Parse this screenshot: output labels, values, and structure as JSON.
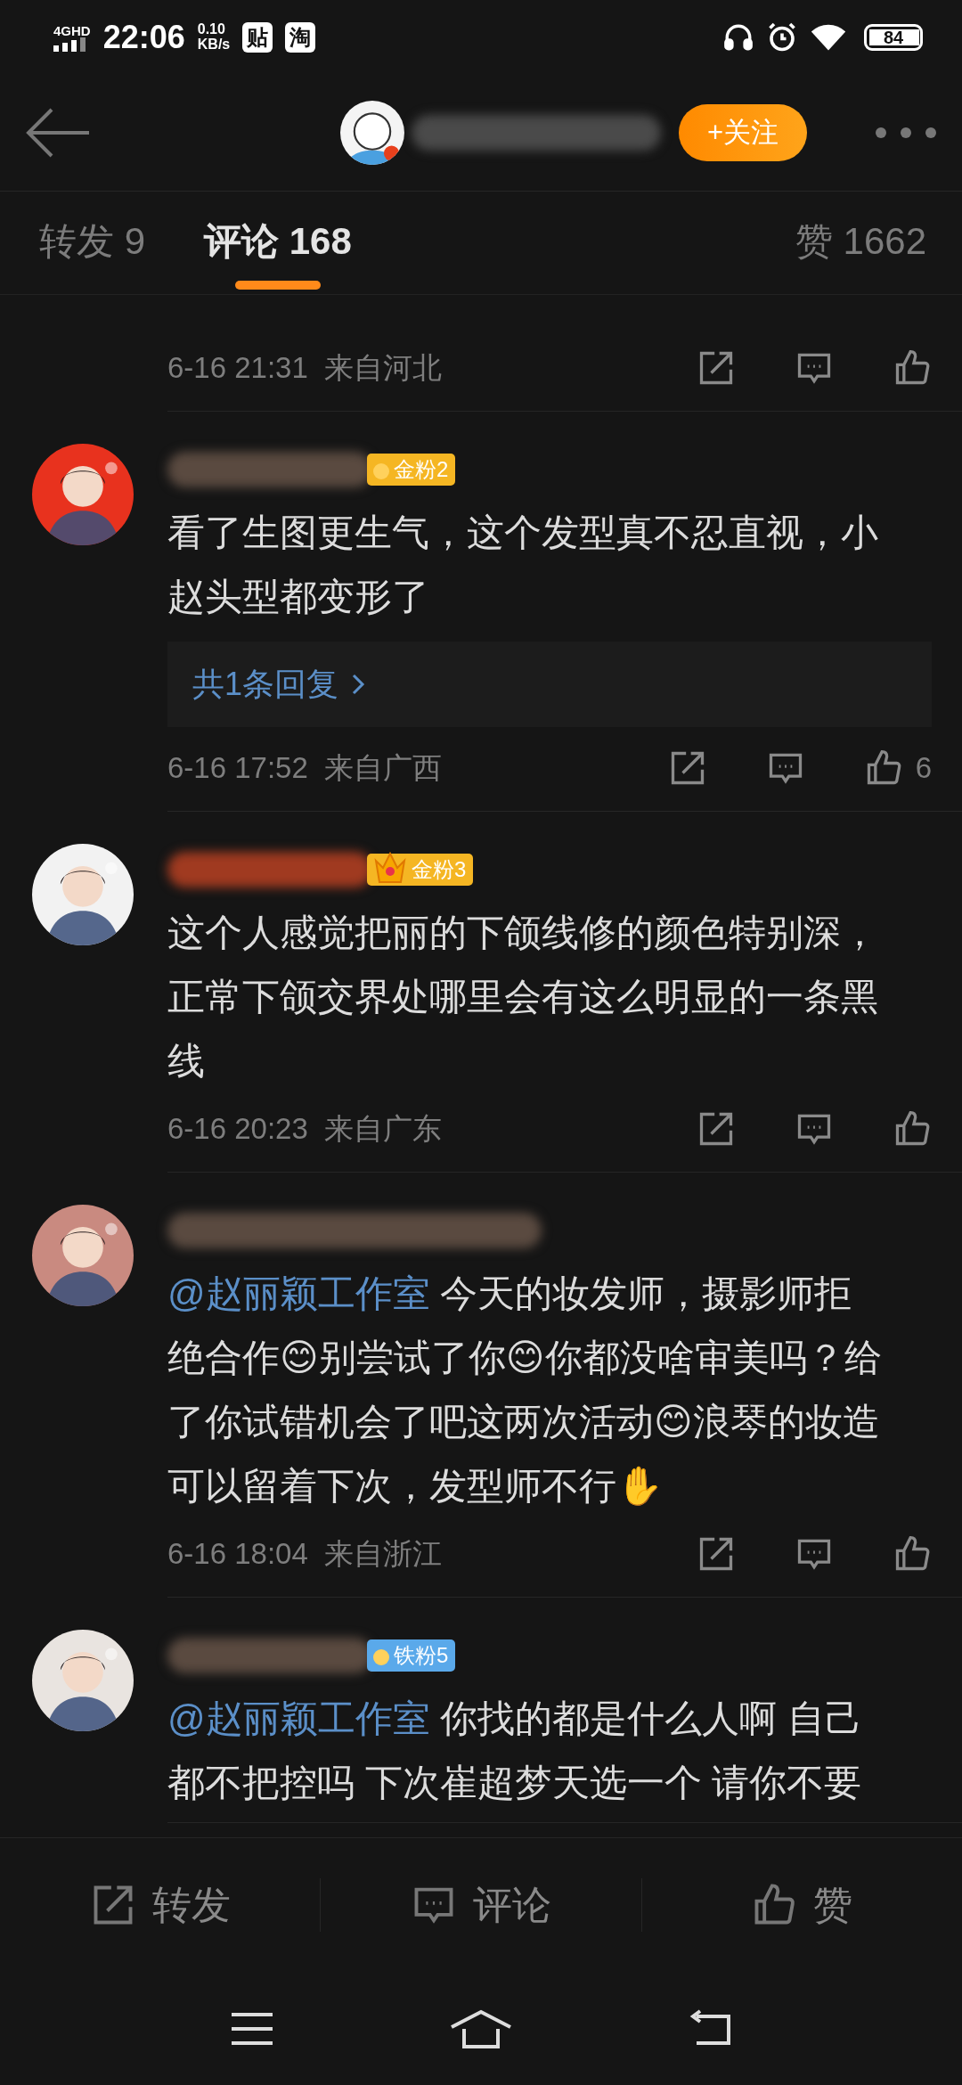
{
  "status_bar": {
    "network": "4G",
    "network_extra": "HD",
    "time": "22:06",
    "speed_value": "0.10",
    "speed_unit": "KB/s",
    "app_badges": [
      "贴",
      "淘"
    ],
    "battery": "84"
  },
  "header": {
    "follow_button": "+关注"
  },
  "tabs": [
    {
      "label": "转发 9",
      "selected": false
    },
    {
      "label": "评论 168",
      "selected": true
    },
    {
      "label": "赞 1662",
      "selected": false
    }
  ],
  "comments": [
    {
      "kind": "cut",
      "time": "6-16 21:31",
      "location": "来自河北"
    },
    {
      "kind": "full",
      "badge": {
        "label": "金粉2",
        "color": "#f5b623",
        "kind": "medal"
      },
      "lines": [
        "看了生图更生气，这个发型真不忍直视，小",
        "赵头型都变形了"
      ],
      "replies": "共1条回复",
      "time": "6-16 17:52",
      "location": "来自广西",
      "likes": "6"
    },
    {
      "kind": "full",
      "badge": {
        "label": "金粉3",
        "color": "#f5b623",
        "kind": "crown"
      },
      "lines": [
        "这个人感觉把丽的下颌线修的颜色特别深，",
        "正常下颌交界处哪里会有这么明显的一条黑",
        "线"
      ],
      "time": "6-16 20:23",
      "location": "来自广东"
    },
    {
      "kind": "full",
      "mention": "@赵丽颖工作室",
      "lines": [
        " 今天的妆发师，摄影师拒",
        "绝合作😊别尝试了你😊你都没啥审美吗？给",
        "了你试错机会了吧这两次活动😊浪琴的妆造",
        "可以留着下次，发型师不行✋"
      ],
      "time": "6-16 18:04",
      "location": "来自浙江"
    },
    {
      "kind": "full",
      "badge": {
        "label": "铁粉5",
        "color": "#5aa9ea",
        "kind": "medal"
      },
      "mention": "@赵丽颖工作室",
      "lines": [
        " 你找的都是什么人啊 自己",
        "都不把控吗 下次崔超梦天选一个 请你不要"
      ]
    }
  ],
  "bottom_actions": [
    {
      "kind": "repost",
      "label": "转发"
    },
    {
      "kind": "comment",
      "label": "评论"
    },
    {
      "kind": "like",
      "label": "赞"
    }
  ]
}
